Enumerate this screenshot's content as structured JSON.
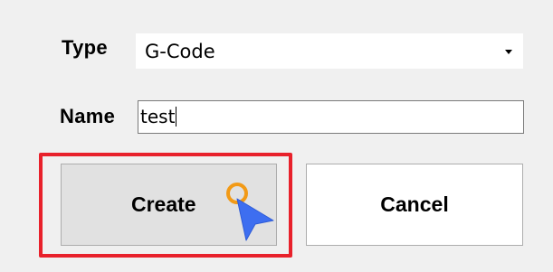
{
  "form": {
    "type_label": "Type",
    "type_value": "G-Code",
    "name_label": "Name",
    "name_value": "test"
  },
  "buttons": {
    "create_label": "Create",
    "cancel_label": "Cancel"
  },
  "icons": {
    "dropdown": "chevron-down-icon",
    "pointer": "pointer-cursor-icon"
  },
  "colors": {
    "highlight": "#e8212b",
    "pointer_blue": "#3d6ef0",
    "pointer_orange": "#f29a16"
  }
}
